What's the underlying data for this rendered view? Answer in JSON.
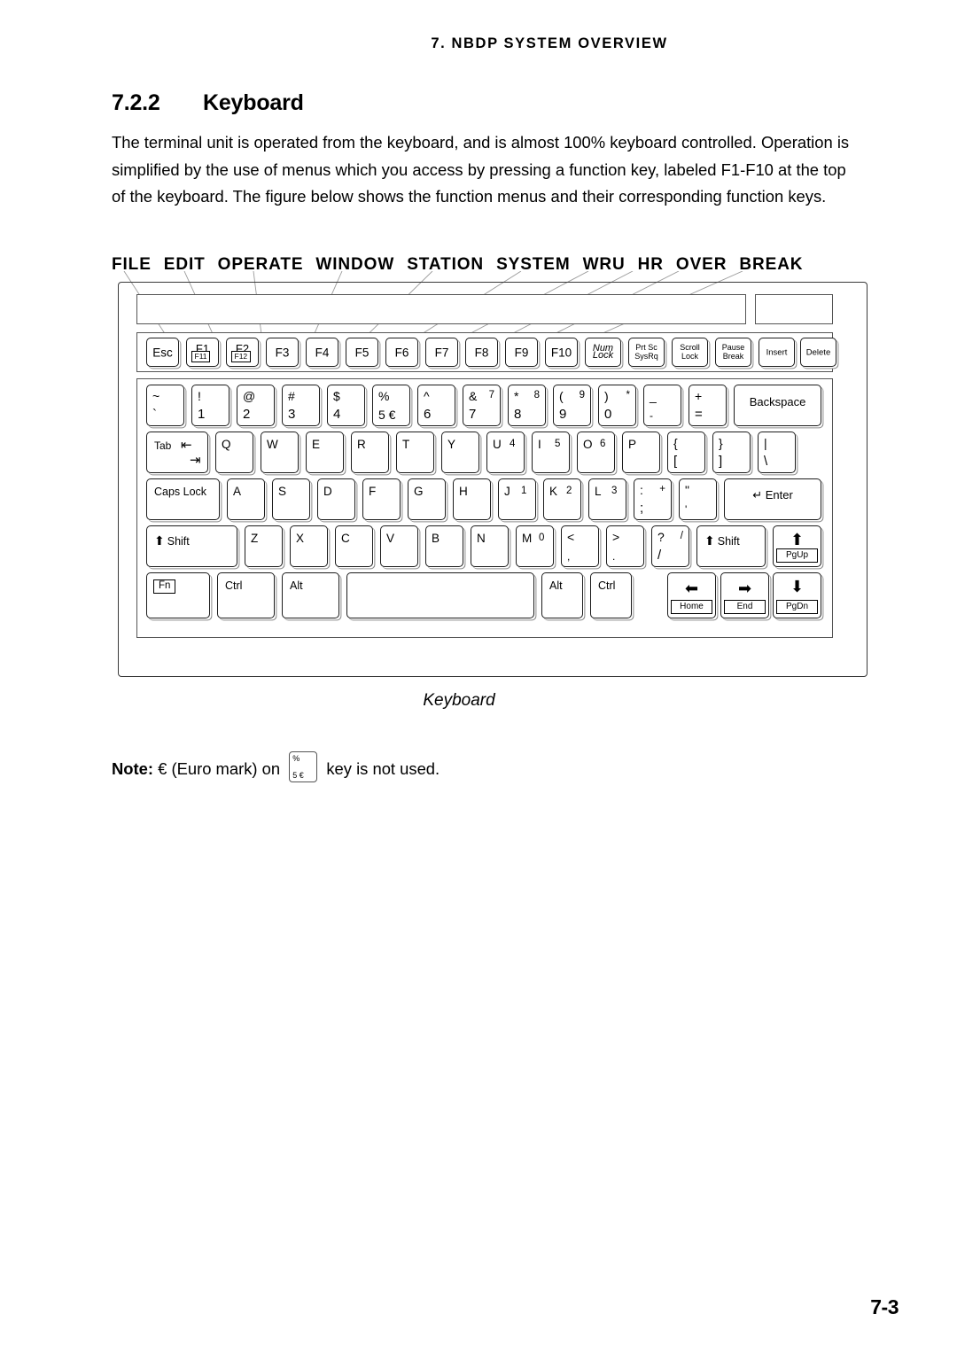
{
  "header": {
    "running_head": "7. NBDP SYSTEM OVERVIEW"
  },
  "section": {
    "number": "7.2.2",
    "title": "Keyboard"
  },
  "body": {
    "paragraph": "The terminal unit is operated from the keyboard, and is almost 100% keyboard controlled. Operation is simplified by the use of menus which you access by pressing a function key, labeled F1-F10 at the top of the keyboard. The figure below shows the function menus and their corresponding function keys."
  },
  "menu_strip": {
    "items": [
      "FILE",
      "EDIT",
      "OPERATE",
      "WINDOW",
      "STATION",
      "SYSTEM",
      "WRU",
      "HR",
      "OVER",
      "BREAK"
    ]
  },
  "figure": {
    "caption": "Keyboard",
    "function_row": [
      {
        "main": "Esc"
      },
      {
        "main": "F1",
        "sub": "F11"
      },
      {
        "main": "F2",
        "sub": "F12"
      },
      {
        "main": "F3"
      },
      {
        "main": "F4"
      },
      {
        "main": "F5"
      },
      {
        "main": "F6"
      },
      {
        "main": "F7"
      },
      {
        "main": "F8"
      },
      {
        "main": "F9"
      },
      {
        "main": "F10"
      },
      {
        "line1": "Num",
        "line2": "Lock",
        "italic": true
      },
      {
        "line1": "Prt Sc",
        "line2": "SysRq"
      },
      {
        "line1": "Scroll",
        "line2": "Lock"
      },
      {
        "line1": "Pause",
        "line2": "Break"
      },
      {
        "line1": "Insert"
      },
      {
        "line1": "Delete"
      }
    ],
    "number_row": [
      {
        "upper": "~",
        "lower": "`"
      },
      {
        "upper": "!",
        "lower": "1"
      },
      {
        "upper": "@",
        "lower": "2"
      },
      {
        "upper": "#",
        "lower": "3"
      },
      {
        "upper": "$",
        "lower": "4"
      },
      {
        "upper": "%",
        "lower": "5 €"
      },
      {
        "upper": "^",
        "lower": "6"
      },
      {
        "upper": "&",
        "upper_right": "7",
        "lower": "7"
      },
      {
        "upper": "*",
        "upper_right": "8",
        "lower": "8"
      },
      {
        "upper": "(",
        "upper_right": "9",
        "lower": "9"
      },
      {
        "upper": ")",
        "upper_right": "*",
        "lower": "0"
      },
      {
        "upper": "_",
        "lower": "-"
      },
      {
        "upper": "+",
        "lower": "="
      },
      {
        "wide_label": "Backspace"
      }
    ],
    "q_row": {
      "tab_label": "Tab",
      "keys": [
        {
          "main": "Q"
        },
        {
          "main": "W"
        },
        {
          "main": "E"
        },
        {
          "main": "R"
        },
        {
          "main": "T"
        },
        {
          "main": "Y"
        },
        {
          "main": "U",
          "num": "4"
        },
        {
          "main": "I",
          "num": "5"
        },
        {
          "main": "O",
          "num": "6"
        },
        {
          "main": "P"
        },
        {
          "upper": "{",
          "lower": "["
        },
        {
          "upper": "}",
          "lower": "]"
        },
        {
          "upper": "|",
          "lower": "\\"
        }
      ]
    },
    "a_row": {
      "caps_label": "Caps Lock",
      "enter_label": "Enter",
      "keys": [
        {
          "main": "A"
        },
        {
          "main": "S"
        },
        {
          "main": "D"
        },
        {
          "main": "F"
        },
        {
          "main": "G"
        },
        {
          "main": "H"
        },
        {
          "main": "J",
          "num": "1"
        },
        {
          "main": "K",
          "num": "2"
        },
        {
          "main": "L",
          "num": "3"
        },
        {
          "upper": ":",
          "upper_right": "+",
          "lower": ";"
        },
        {
          "upper": "\"",
          "lower": "'"
        }
      ]
    },
    "z_row": {
      "shift_left_label": "Shift",
      "shift_right_label": "Shift",
      "pgup_label": "PgUp",
      "keys": [
        {
          "main": "Z"
        },
        {
          "main": "X"
        },
        {
          "main": "C"
        },
        {
          "main": "V"
        },
        {
          "main": "B"
        },
        {
          "main": "N"
        },
        {
          "main": "M",
          "num": "0"
        },
        {
          "upper": "<",
          "lower": ","
        },
        {
          "upper": ">",
          "lower": "."
        },
        {
          "upper": "?",
          "upper_right": "/",
          "lower": "/"
        }
      ]
    },
    "bottom_row": {
      "fn_label": "Fn",
      "ctrl_left_label": "Ctrl",
      "alt_left_label": "Alt",
      "space_label": "",
      "alt_right_label": "Alt",
      "ctrl_right_label": "Ctrl",
      "home_label": "Home",
      "end_label": "End",
      "pgdn_label": "PgDn"
    }
  },
  "note": {
    "label": "Note:",
    "text_before": "€  (Euro mark) on",
    "key_upper": "%",
    "key_lower": "5 €",
    "text_after": "key is not used."
  },
  "footer": {
    "page_number": "7-3"
  }
}
